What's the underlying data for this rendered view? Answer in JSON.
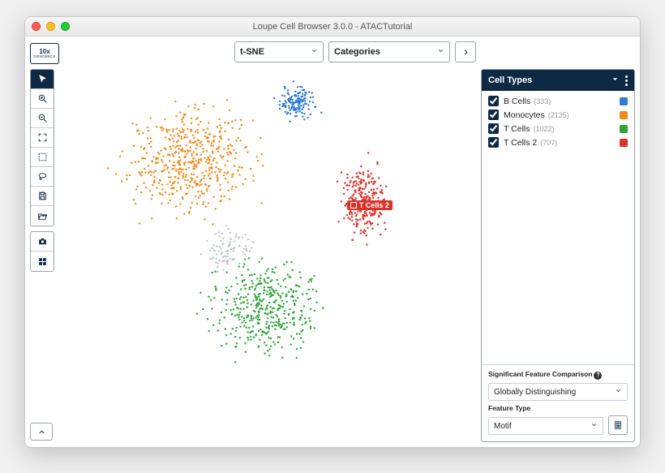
{
  "window_title": "Loupe Cell Browser 3.0.0 - ATACTutorial",
  "logo": {
    "top": "10x",
    "bottom": "GENOMICS"
  },
  "top_controls": {
    "projection": "t-SNE",
    "mode": "Categories"
  },
  "panel": {
    "title": "Cell Types",
    "items": [
      {
        "label": "B Cells",
        "count": "(333)",
        "color": "#2e7bd1",
        "checked": true
      },
      {
        "label": "Monocytes",
        "count": "(2135)",
        "color": "#f28b1d",
        "checked": true
      },
      {
        "label": "T Cells",
        "count": "(1022)",
        "color": "#2fa23b",
        "checked": true
      },
      {
        "label": "T Cells 2",
        "count": "(707)",
        "color": "#d9342b",
        "checked": true
      }
    ]
  },
  "annotation": {
    "label": "T Cells 2"
  },
  "bottom": {
    "feature_comparison_label": "Significant Feature Comparison",
    "feature_comparison_value": "Globally Distinguishing",
    "feature_type_label": "Feature Type",
    "feature_type_value": "Motif"
  },
  "clusters": [
    {
      "color": "#f28b1d",
      "n": 520,
      "cx": 0.3,
      "cy": 0.3,
      "rx": 0.23,
      "ry": 0.2
    },
    {
      "color": "#2e7bd1",
      "n": 140,
      "cx": 0.56,
      "cy": 0.16,
      "rx": 0.065,
      "ry": 0.07
    },
    {
      "color": "#d9342b",
      "n": 260,
      "cx": 0.72,
      "cy": 0.4,
      "rx": 0.085,
      "ry": 0.14
    },
    {
      "color": "#2fa23b",
      "n": 420,
      "cx": 0.48,
      "cy": 0.66,
      "rx": 0.22,
      "ry": 0.18
    },
    {
      "color": "#bfc5ca",
      "n": 90,
      "cx": 0.4,
      "cy": 0.52,
      "rx": 0.09,
      "ry": 0.08
    }
  ]
}
